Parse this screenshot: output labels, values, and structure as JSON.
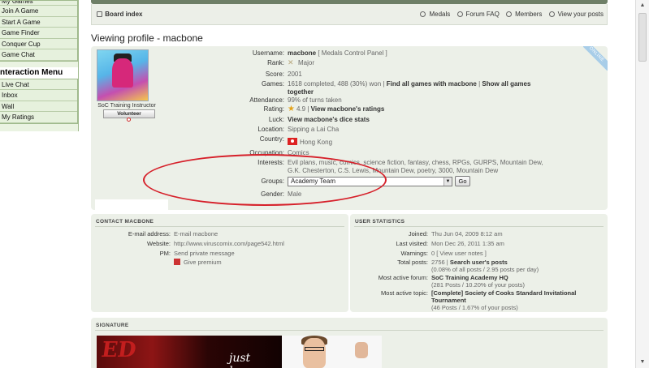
{
  "sidebar": {
    "items_top": [
      "My Games",
      "Join A Game",
      "Start A Game",
      "Game Finder",
      "Conquer Cup",
      "Game Chat"
    ],
    "interaction_title": "nteraction Menu",
    "items_interaction": [
      "Live Chat",
      "Inbox",
      "Wall",
      "My Ratings"
    ]
  },
  "navbar": {
    "home": "Board index",
    "links": [
      "Medals",
      "Forum FAQ",
      "Members",
      "View your posts"
    ]
  },
  "page_title": "Viewing profile - macbone",
  "profile": {
    "online_badge": "ONLINE",
    "avatar_caption": "SoC Training Instructor",
    "volunteer_badge": "Volunteer",
    "fields": {
      "username_label": "Username:",
      "username": "macbone",
      "username_extra": "[ Medals Control Panel ]",
      "rank_label": "Rank:",
      "rank": "Major",
      "score_label": "Score:",
      "score": "2001",
      "games_label": "Games:",
      "games": "1618 completed, 488 (30%) won |",
      "games_link1": "Find all games with macbone",
      "games_sep": "|",
      "games_link2": "Show all games together",
      "attendance_label": "Attendance:",
      "attendance": "99% of turns taken",
      "rating_label": "Rating:",
      "rating": "4.9 |",
      "rating_link": "View macbone's ratings",
      "luck_label": "Luck:",
      "luck_link": "View macbone's dice stats",
      "location_label": "Location:",
      "location": "Sipping a Lai Cha",
      "country_label": "Country:",
      "country": "Hong Kong",
      "occupation_label": "Occupation:",
      "occupation": "Comics",
      "interests_label": "Interests:",
      "interests": "Evil plans, music, comics, science fiction, fantasy, chess, RPGs, GURPS, Mountain Dew, G.K. Chesterton, C.S. Lewis, Mountain Dew, poetry, 3000, Mountain Dew",
      "groups_label": "Groups:",
      "groups_selected": "Academy Team",
      "go_button": "Go",
      "gender_label": "Gender:",
      "gender": "Male"
    }
  },
  "contact": {
    "title": "CONTACT MACBONE",
    "email_label": "E-mail address:",
    "email": "E-mail macbone",
    "website_label": "Website:",
    "website": "http://www.viruscomix.com/page542.html",
    "pm_label": "PM:",
    "pm": "Send private message",
    "premium": "Give premium"
  },
  "stats": {
    "title": "USER STATISTICS",
    "joined_label": "Joined:",
    "joined": "Thu Jun 04, 2009 8:12 am",
    "visited_label": "Last visited:",
    "visited": "Mon Dec 26, 2011 1:35 am",
    "warnings_label": "Warnings:",
    "warnings": "0 [ View user notes ]",
    "posts_label": "Total posts:",
    "posts": "2756 |",
    "posts_link": "Search user's posts",
    "posts_sub": "(0.08% of all posts / 2.95 posts per day)",
    "forum_label": "Most active forum:",
    "forum": "SoC Training Academy HQ",
    "forum_sub": "(281 Posts / 10.20% of your posts)",
    "topic_label": "Most active topic:",
    "topic": "[Complete] Society of Cooks Standard Invitational Tournament",
    "topic_sub": "(46 Posts / 1.67% of your posts)"
  },
  "signature": {
    "title": "SIGNATURE",
    "img_text": "ED",
    "img_text2": "just because"
  },
  "colors": {
    "panel": "#ecf0e8",
    "sidebar": "#e6f1dd",
    "annotation": "#d6202a"
  }
}
